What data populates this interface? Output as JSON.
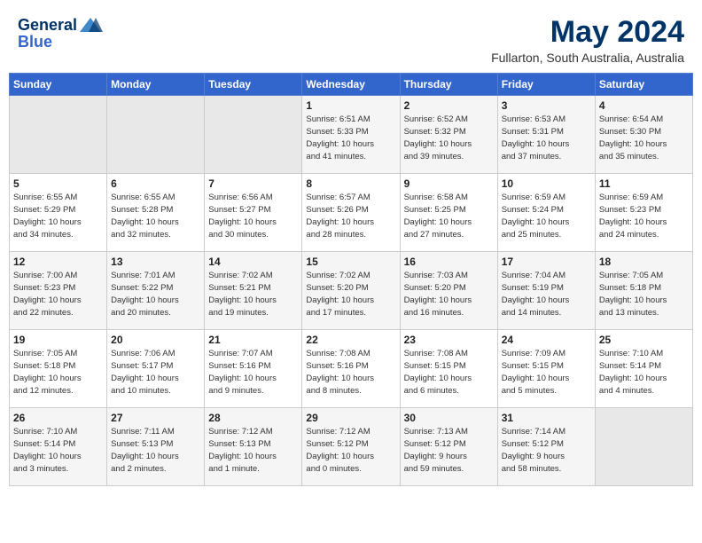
{
  "header": {
    "logo_line1": "General",
    "logo_line2": "Blue",
    "month": "May 2024",
    "location": "Fullarton, South Australia, Australia"
  },
  "weekdays": [
    "Sunday",
    "Monday",
    "Tuesday",
    "Wednesday",
    "Thursday",
    "Friday",
    "Saturday"
  ],
  "weeks": [
    [
      {
        "day": "",
        "content": ""
      },
      {
        "day": "",
        "content": ""
      },
      {
        "day": "",
        "content": ""
      },
      {
        "day": "1",
        "content": "Sunrise: 6:51 AM\nSunset: 5:33 PM\nDaylight: 10 hours\nand 41 minutes."
      },
      {
        "day": "2",
        "content": "Sunrise: 6:52 AM\nSunset: 5:32 PM\nDaylight: 10 hours\nand 39 minutes."
      },
      {
        "day": "3",
        "content": "Sunrise: 6:53 AM\nSunset: 5:31 PM\nDaylight: 10 hours\nand 37 minutes."
      },
      {
        "day": "4",
        "content": "Sunrise: 6:54 AM\nSunset: 5:30 PM\nDaylight: 10 hours\nand 35 minutes."
      }
    ],
    [
      {
        "day": "5",
        "content": "Sunrise: 6:55 AM\nSunset: 5:29 PM\nDaylight: 10 hours\nand 34 minutes."
      },
      {
        "day": "6",
        "content": "Sunrise: 6:55 AM\nSunset: 5:28 PM\nDaylight: 10 hours\nand 32 minutes."
      },
      {
        "day": "7",
        "content": "Sunrise: 6:56 AM\nSunset: 5:27 PM\nDaylight: 10 hours\nand 30 minutes."
      },
      {
        "day": "8",
        "content": "Sunrise: 6:57 AM\nSunset: 5:26 PM\nDaylight: 10 hours\nand 28 minutes."
      },
      {
        "day": "9",
        "content": "Sunrise: 6:58 AM\nSunset: 5:25 PM\nDaylight: 10 hours\nand 27 minutes."
      },
      {
        "day": "10",
        "content": "Sunrise: 6:59 AM\nSunset: 5:24 PM\nDaylight: 10 hours\nand 25 minutes."
      },
      {
        "day": "11",
        "content": "Sunrise: 6:59 AM\nSunset: 5:23 PM\nDaylight: 10 hours\nand 24 minutes."
      }
    ],
    [
      {
        "day": "12",
        "content": "Sunrise: 7:00 AM\nSunset: 5:23 PM\nDaylight: 10 hours\nand 22 minutes."
      },
      {
        "day": "13",
        "content": "Sunrise: 7:01 AM\nSunset: 5:22 PM\nDaylight: 10 hours\nand 20 minutes."
      },
      {
        "day": "14",
        "content": "Sunrise: 7:02 AM\nSunset: 5:21 PM\nDaylight: 10 hours\nand 19 minutes."
      },
      {
        "day": "15",
        "content": "Sunrise: 7:02 AM\nSunset: 5:20 PM\nDaylight: 10 hours\nand 17 minutes."
      },
      {
        "day": "16",
        "content": "Sunrise: 7:03 AM\nSunset: 5:20 PM\nDaylight: 10 hours\nand 16 minutes."
      },
      {
        "day": "17",
        "content": "Sunrise: 7:04 AM\nSunset: 5:19 PM\nDaylight: 10 hours\nand 14 minutes."
      },
      {
        "day": "18",
        "content": "Sunrise: 7:05 AM\nSunset: 5:18 PM\nDaylight: 10 hours\nand 13 minutes."
      }
    ],
    [
      {
        "day": "19",
        "content": "Sunrise: 7:05 AM\nSunset: 5:18 PM\nDaylight: 10 hours\nand 12 minutes."
      },
      {
        "day": "20",
        "content": "Sunrise: 7:06 AM\nSunset: 5:17 PM\nDaylight: 10 hours\nand 10 minutes."
      },
      {
        "day": "21",
        "content": "Sunrise: 7:07 AM\nSunset: 5:16 PM\nDaylight: 10 hours\nand 9 minutes."
      },
      {
        "day": "22",
        "content": "Sunrise: 7:08 AM\nSunset: 5:16 PM\nDaylight: 10 hours\nand 8 minutes."
      },
      {
        "day": "23",
        "content": "Sunrise: 7:08 AM\nSunset: 5:15 PM\nDaylight: 10 hours\nand 6 minutes."
      },
      {
        "day": "24",
        "content": "Sunrise: 7:09 AM\nSunset: 5:15 PM\nDaylight: 10 hours\nand 5 minutes."
      },
      {
        "day": "25",
        "content": "Sunrise: 7:10 AM\nSunset: 5:14 PM\nDaylight: 10 hours\nand 4 minutes."
      }
    ],
    [
      {
        "day": "26",
        "content": "Sunrise: 7:10 AM\nSunset: 5:14 PM\nDaylight: 10 hours\nand 3 minutes."
      },
      {
        "day": "27",
        "content": "Sunrise: 7:11 AM\nSunset: 5:13 PM\nDaylight: 10 hours\nand 2 minutes."
      },
      {
        "day": "28",
        "content": "Sunrise: 7:12 AM\nSunset: 5:13 PM\nDaylight: 10 hours\nand 1 minute."
      },
      {
        "day": "29",
        "content": "Sunrise: 7:12 AM\nSunset: 5:12 PM\nDaylight: 10 hours\nand 0 minutes."
      },
      {
        "day": "30",
        "content": "Sunrise: 7:13 AM\nSunset: 5:12 PM\nDaylight: 9 hours\nand 59 minutes."
      },
      {
        "day": "31",
        "content": "Sunrise: 7:14 AM\nSunset: 5:12 PM\nDaylight: 9 hours\nand 58 minutes."
      },
      {
        "day": "",
        "content": ""
      }
    ]
  ]
}
